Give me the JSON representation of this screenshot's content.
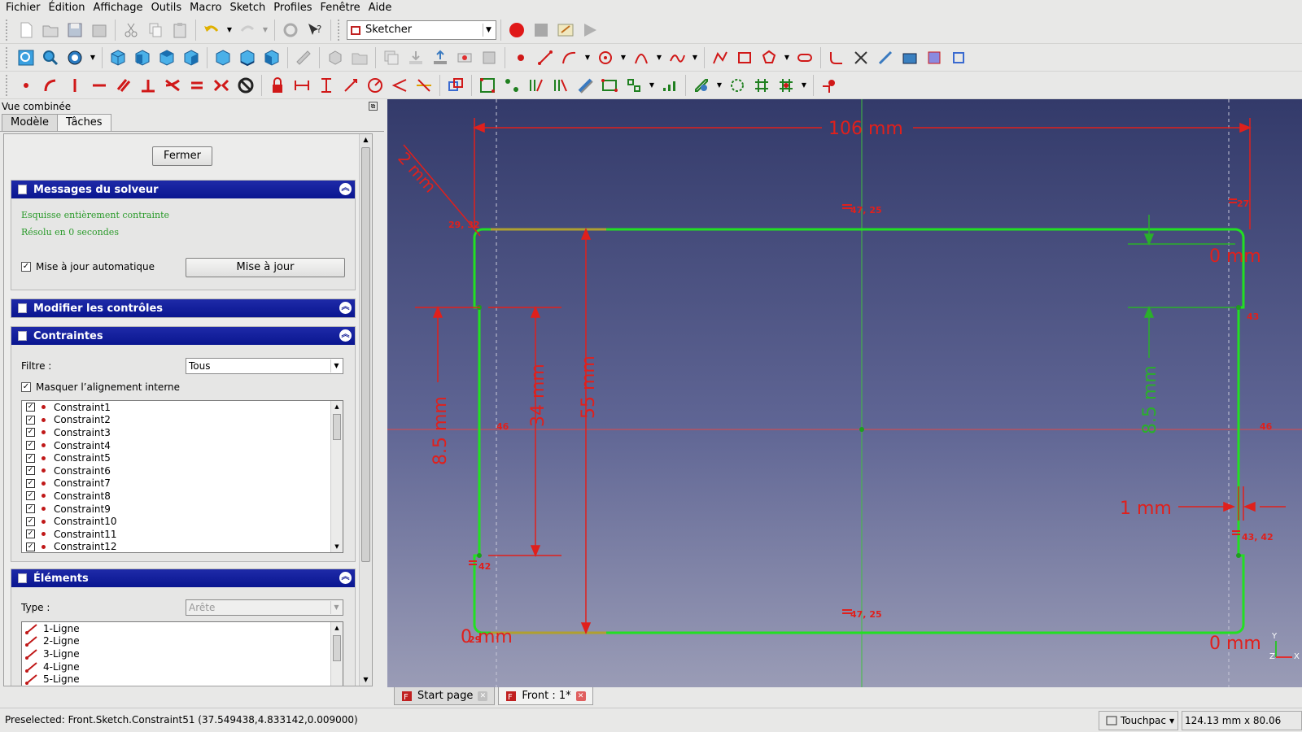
{
  "menu": [
    "Fichier",
    "Édition",
    "Affichage",
    "Outils",
    "Macro",
    "Sketch",
    "Profiles",
    "Fenêtre",
    "Aide"
  ],
  "workbench": {
    "selected": "Sketcher"
  },
  "toolbar1_icons": [
    "new-document-icon",
    "open-icon",
    "save-icon",
    "save-as-icon",
    "cut-icon",
    "copy-icon",
    "paste-icon",
    "undo-icon",
    "redo-icon",
    "refresh-icon",
    "whats-this-icon"
  ],
  "toolbar2_icons": [
    "fit-all-icon",
    "fit-selection-icon",
    "draw-style-icon",
    "isometric-view-icon",
    "front-view-icon",
    "top-view-icon",
    "right-view-icon",
    "rear-view-icon",
    "bottom-view-icon",
    "left-view-icon",
    "measure-icon",
    "part-icon",
    "group-icon"
  ],
  "toolbar3_icons": [
    "point-icon",
    "polyline-icon",
    "vertical-icon",
    "horizontal-icon",
    "parallel-icon",
    "perpendicular-icon",
    "tangent-icon",
    "equal-icon",
    "symmetric-icon",
    "block-icon",
    "lock-icon",
    "horizontal-distance-icon",
    "vertical-distance-icon",
    "distance-icon",
    "radius-icon",
    "angle-icon",
    "snell-icon",
    "toggle-constraint-icon"
  ],
  "panel": {
    "title": "Vue combinée",
    "tabs": [
      "Modèle",
      "Tâches"
    ],
    "close_button": "Fermer",
    "solver": {
      "title": "Messages du solveur",
      "msg1": "Esquisse entièrement contrainte",
      "msg2": "Résolu en 0 secondes",
      "auto_update_label": "Mise à jour automatique",
      "update_button": "Mise à jour"
    },
    "edit_controls": {
      "title": "Modifier les contrôles"
    },
    "constraints": {
      "title": "Contraintes",
      "filter_label": "Filtre :",
      "filter_value": "Tous",
      "hide_internal_label": "Masquer l’alignement interne",
      "items": [
        "Constraint1",
        "Constraint2",
        "Constraint3",
        "Constraint4",
        "Constraint5",
        "Constraint6",
        "Constraint7",
        "Constraint8",
        "Constraint9",
        "Constraint10",
        "Constraint11",
        "Constraint12"
      ]
    },
    "elements": {
      "title": "Éléments",
      "type_label": "Type :",
      "type_value": "Arête",
      "items": [
        "1-Ligne",
        "2-Ligne",
        "3-Ligne",
        "4-Ligne",
        "5-Ligne"
      ]
    }
  },
  "viewport": {
    "dim_106": "106 mm",
    "dim_2": "2 mm",
    "dim_34": "34 mm",
    "dim_55": "55 mm",
    "dim_85_left": "8.5 mm",
    "dim_85_right": "8.5 mm",
    "dim_1": "1 mm",
    "dim_0_tr": "0 mm",
    "dim_0_br": "0 mm",
    "dim_0_bl": "0 mm",
    "lbl_47_25_top": "47, 25",
    "lbl_47_25_bot": "47, 25",
    "lbl_27": "27",
    "lbl_29": "29, 32",
    "lbl_43": "43",
    "lbl_46_l": "46",
    "lbl_46_r": "46",
    "lbl_42": "42",
    "lbl_43_42": "43, 42",
    "lbl_29_b": "29",
    "axis_y": "Y",
    "axis_z": "Z",
    "axis_x": "X",
    "colors": {
      "geometry": "#22e022",
      "constraint": "#e0201c",
      "axis_h": "#e04040",
      "axis_v": "#40c040"
    }
  },
  "view_tabs": [
    {
      "label": "Start page",
      "active": false
    },
    {
      "label": "Front : 1*",
      "active": true
    }
  ],
  "status": {
    "message": "Preselected: Front.Sketch.Constraint51 (37.549438,4.833142,0.009000)",
    "nav_style": "Touchpac",
    "dimensions": "124.13 mm x 80.06 mm"
  }
}
